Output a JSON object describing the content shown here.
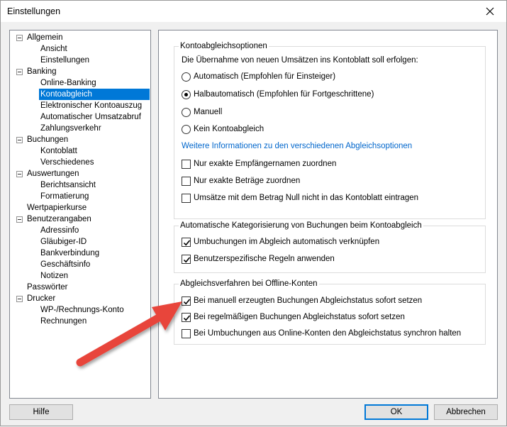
{
  "window": {
    "title": "Einstellungen"
  },
  "tree": {
    "items": [
      {
        "label": "Allgemein",
        "level": 0,
        "expander": true
      },
      {
        "label": "Ansicht",
        "level": 1
      },
      {
        "label": "Einstellungen",
        "level": 1
      },
      {
        "label": "Banking",
        "level": 0,
        "expander": true
      },
      {
        "label": "Online-Banking",
        "level": 1
      },
      {
        "label": "Kontoabgleich",
        "level": 1,
        "selected": true
      },
      {
        "label": "Elektronischer Kontoauszug",
        "level": 1
      },
      {
        "label": "Automatischer Umsatzabruf",
        "level": 1
      },
      {
        "label": "Zahlungsverkehr",
        "level": 1
      },
      {
        "label": "Buchungen",
        "level": 0,
        "expander": true
      },
      {
        "label": "Kontoblatt",
        "level": 1
      },
      {
        "label": "Verschiedenes",
        "level": 1
      },
      {
        "label": "Auswertungen",
        "level": 0,
        "expander": true
      },
      {
        "label": "Berichtsansicht",
        "level": 1
      },
      {
        "label": "Formatierung",
        "level": 1
      },
      {
        "label": "Wertpapierkurse",
        "level": 0
      },
      {
        "label": "Benutzerangaben",
        "level": 0,
        "expander": true
      },
      {
        "label": "Adressinfo",
        "level": 1
      },
      {
        "label": "Gläubiger-ID",
        "level": 1
      },
      {
        "label": "Bankverbindung",
        "level": 1
      },
      {
        "label": "Geschäftsinfo",
        "level": 1
      },
      {
        "label": "Notizen",
        "level": 1
      },
      {
        "label": "Passwörter",
        "level": 0
      },
      {
        "label": "Drucker",
        "level": 0,
        "expander": true
      },
      {
        "label": "WP-/Rechnungs-Konto",
        "level": 1
      },
      {
        "label": "Rechnungen",
        "level": 1
      }
    ]
  },
  "kontoabgleich": {
    "title": "Kontoabgleichsoptionen",
    "intro": "Die Übernahme von neuen Umsätzen ins Kontoblatt soll erfolgen:",
    "radios": [
      {
        "label": "Automatisch (Empfohlen für Einsteiger)",
        "checked": false
      },
      {
        "label": "Halbautomatisch (Empfohlen für Fortgeschrittene)",
        "checked": true
      },
      {
        "label": "Manuell",
        "checked": false
      },
      {
        "label": "Kein Kontoabgleich",
        "checked": false
      }
    ],
    "link": "Weitere Informationen zu den verschiedenen Abgleichsoptionen",
    "checkboxes": [
      {
        "label": "Nur exakte Empfängernamen zuordnen",
        "checked": false
      },
      {
        "label": "Nur exakte Beträge zuordnen",
        "checked": false
      },
      {
        "label": "Umsätze mit dem Betrag Null nicht in das Kontoblatt eintragen",
        "checked": false
      }
    ]
  },
  "kategorisierung": {
    "title": "Automatische Kategorisierung von Buchungen beim Kontoabgleich",
    "checkboxes": [
      {
        "label": "Umbuchungen im Abgleich automatisch verknüpfen",
        "checked": true
      },
      {
        "label": "Benutzerspezifische Regeln anwenden",
        "checked": true
      }
    ]
  },
  "offline": {
    "title": "Abgleichsverfahren bei Offline-Konten",
    "checkboxes": [
      {
        "label": "Bei manuell erzeugten Buchungen Abgleichstatus sofort setzen",
        "checked": true
      },
      {
        "label": "Bei regelmäßigen Buchungen Abgleichstatus sofort setzen",
        "checked": true
      },
      {
        "label": "Bei Umbuchungen aus Online-Konten den Abgleichstatus synchron halten",
        "checked": false
      }
    ]
  },
  "buttons": {
    "help": "Hilfe",
    "ok": "OK",
    "cancel": "Abbrechen"
  },
  "colors": {
    "selection": "#0078d7",
    "link": "#0066cc",
    "annotation_arrow": "#e8443a"
  },
  "annotation": {
    "icon": "red-arrow-icon"
  }
}
